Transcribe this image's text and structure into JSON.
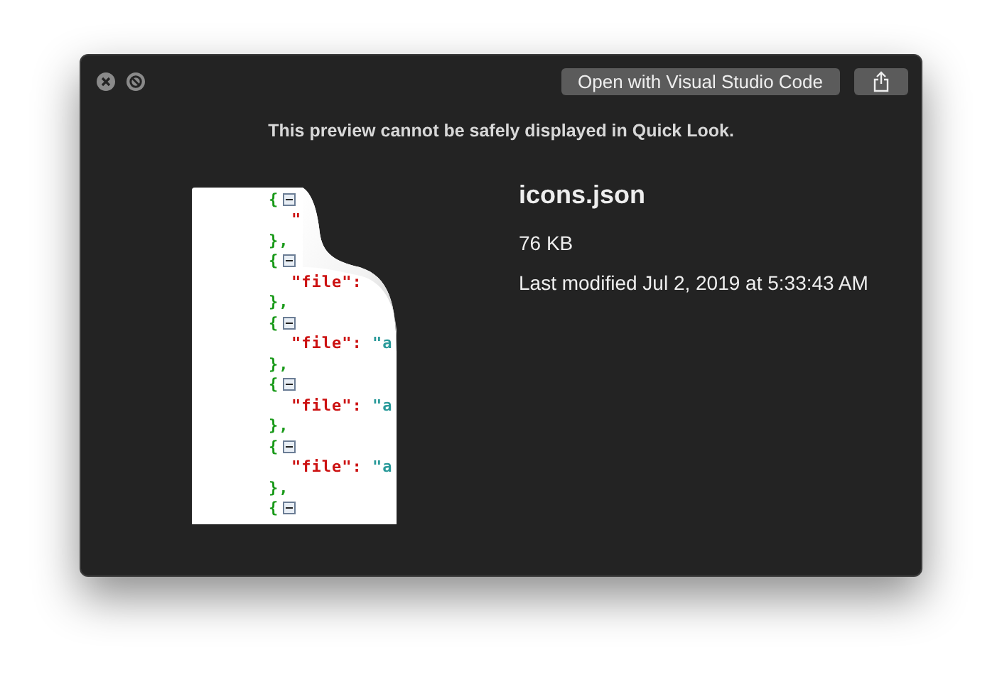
{
  "window": {
    "controls": [
      {
        "kind": "close"
      },
      {
        "kind": "fullscreen"
      }
    ],
    "open_button": "Open with Visual Studio Code",
    "share_button": {
      "kind": "share"
    }
  },
  "notice": "This preview cannot be safely displayed in Quick Look.",
  "document_thumbnail": {
    "lines": [
      {
        "kind": "open",
        "text": "{"
      },
      {
        "kind": "property",
        "key": "\""
      },
      {
        "kind": "close",
        "text": "},"
      },
      {
        "kind": "open",
        "text": "{"
      },
      {
        "kind": "property",
        "key": "\"file\":"
      },
      {
        "kind": "close",
        "text": "},"
      },
      {
        "kind": "open",
        "text": "{"
      },
      {
        "kind": "property",
        "key": "\"file\":",
        "value": "\"a"
      },
      {
        "kind": "close",
        "text": "},"
      },
      {
        "kind": "open",
        "text": "{"
      },
      {
        "kind": "property",
        "key": "\"file\":",
        "value": "\"a"
      },
      {
        "kind": "close",
        "text": "},"
      },
      {
        "kind": "open",
        "text": "{"
      },
      {
        "kind": "property",
        "key": "\"file\":",
        "value": "\"a"
      },
      {
        "kind": "close",
        "text": "},"
      },
      {
        "kind": "open",
        "text": "{"
      }
    ]
  },
  "file": {
    "name": "icons.json",
    "size": "76 KB",
    "modified": "Last modified Jul 2, 2019 at 5:33:43 AM"
  }
}
